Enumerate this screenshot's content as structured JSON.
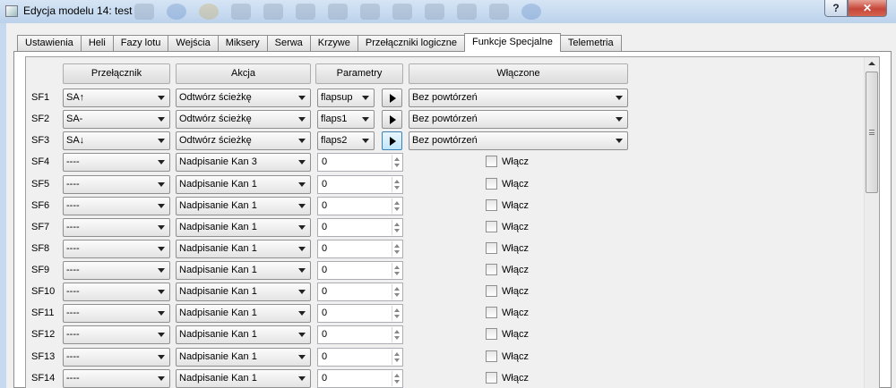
{
  "window": {
    "title": "Edycja modelu 14: test",
    "help_label": "?",
    "close_label": "✕"
  },
  "tabs": [
    {
      "label": "Ustawienia"
    },
    {
      "label": "Heli"
    },
    {
      "label": "Fazy lotu"
    },
    {
      "label": "Wejścia"
    },
    {
      "label": "Miksery"
    },
    {
      "label": "Serwa"
    },
    {
      "label": "Krzywe"
    },
    {
      "label": "Przełączniki logiczne"
    },
    {
      "label": "Funkcje Specjalne",
      "active": true
    },
    {
      "label": "Telemetria"
    }
  ],
  "columns": {
    "switch": "Przełącznik",
    "action": "Akcja",
    "params": "Parametry",
    "enabled": "Włączone"
  },
  "rows": [
    {
      "id": "SF1",
      "switch": "SA↑",
      "action": "Odtwórz ścieżkę",
      "param": "flapsup",
      "enabled": "Bez powtórzeń",
      "kind": "track"
    },
    {
      "id": "SF2",
      "switch": "SA-",
      "action": "Odtwórz ścieżkę",
      "param": "flaps1",
      "enabled": "Bez powtórzeń",
      "kind": "track"
    },
    {
      "id": "SF3",
      "switch": "SA↓",
      "action": "Odtwórz ścieżkę",
      "param": "flaps2",
      "enabled": "Bez powtórzeń",
      "kind": "track",
      "focus": true
    },
    {
      "id": "SF4",
      "switch": "----",
      "action": "Nadpisanie Kan 3",
      "param": "0",
      "enabled": "Włącz",
      "kind": "override"
    },
    {
      "id": "SF5",
      "switch": "----",
      "action": "Nadpisanie Kan 1",
      "param": "0",
      "enabled": "Włącz",
      "kind": "override"
    },
    {
      "id": "SF6",
      "switch": "----",
      "action": "Nadpisanie Kan 1",
      "param": "0",
      "enabled": "Włącz",
      "kind": "override"
    },
    {
      "id": "SF7",
      "switch": "----",
      "action": "Nadpisanie Kan 1",
      "param": "0",
      "enabled": "Włącz",
      "kind": "override"
    },
    {
      "id": "SF8",
      "switch": "----",
      "action": "Nadpisanie Kan 1",
      "param": "0",
      "enabled": "Włącz",
      "kind": "override"
    },
    {
      "id": "SF9",
      "switch": "----",
      "action": "Nadpisanie Kan 1",
      "param": "0",
      "enabled": "Włącz",
      "kind": "override"
    },
    {
      "id": "SF10",
      "switch": "----",
      "action": "Nadpisanie Kan 1",
      "param": "0",
      "enabled": "Włącz",
      "kind": "override"
    },
    {
      "id": "SF11",
      "switch": "----",
      "action": "Nadpisanie Kan 1",
      "param": "0",
      "enabled": "Włącz",
      "kind": "override"
    },
    {
      "id": "SF12",
      "switch": "----",
      "action": "Nadpisanie Kan 1",
      "param": "0",
      "enabled": "Włącz",
      "kind": "override"
    },
    {
      "id": "SF13",
      "switch": "----",
      "action": "Nadpisanie Kan 1",
      "param": "0",
      "enabled": "Włącz",
      "kind": "override"
    },
    {
      "id": "SF14",
      "switch": "----",
      "action": "Nadpisanie Kan 1",
      "param": "0",
      "enabled": "Włącz",
      "kind": "override"
    }
  ]
}
